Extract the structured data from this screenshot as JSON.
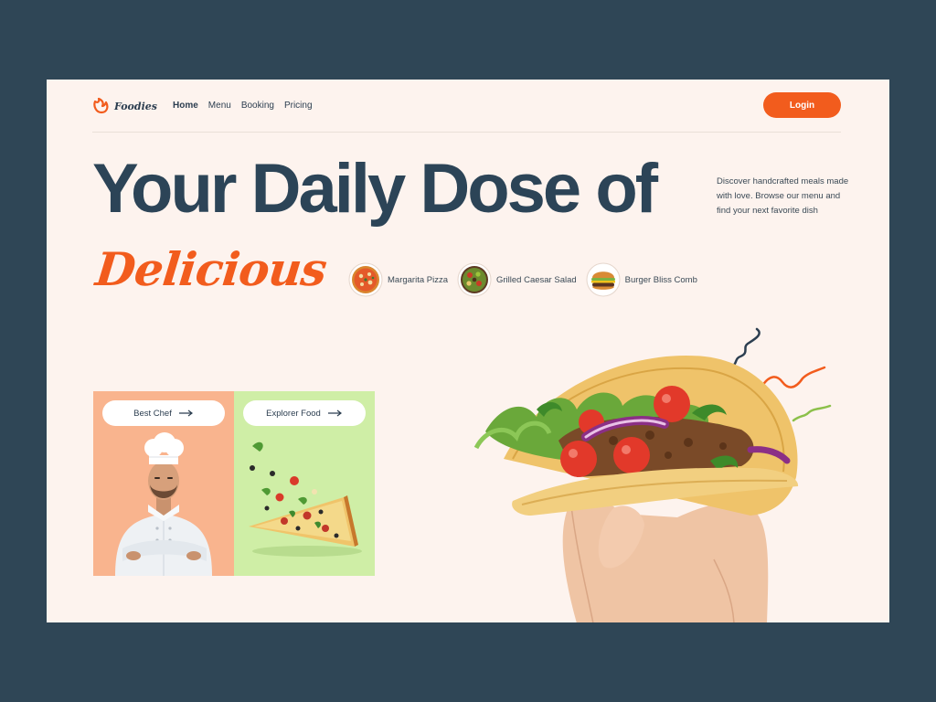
{
  "brand": {
    "name": "Foodies"
  },
  "nav": {
    "links": [
      {
        "label": "Home",
        "active": true
      },
      {
        "label": "Menu",
        "active": false
      },
      {
        "label": "Booking",
        "active": false
      },
      {
        "label": "Pricing",
        "active": false
      }
    ],
    "login_label": "Login"
  },
  "hero": {
    "headline": "Your Daily Dose of",
    "script_word": "Delicious",
    "description": "Discover handcrafted meals made with love. Browse our menu and find your next favorite dish"
  },
  "dishes": [
    {
      "label": "Margarita Pizza",
      "icon": "pizza-icon"
    },
    {
      "label": "Grilled Caesar Salad",
      "icon": "salad-icon"
    },
    {
      "label": "Burger Bliss Comb",
      "icon": "burger-icon"
    }
  ],
  "cards": {
    "chef": {
      "label": "Best Chef",
      "icon": "arrow-right-icon"
    },
    "food": {
      "label": "Explorer Food",
      "icon": "arrow-right-icon"
    }
  },
  "colors": {
    "accent": "#f25c1d",
    "navy": "#2c4457",
    "frame_bg": "#fdf3ee",
    "outer_bg": "#2f4656",
    "chef_card": "#f9b48e",
    "food_card": "#cfeea6"
  }
}
